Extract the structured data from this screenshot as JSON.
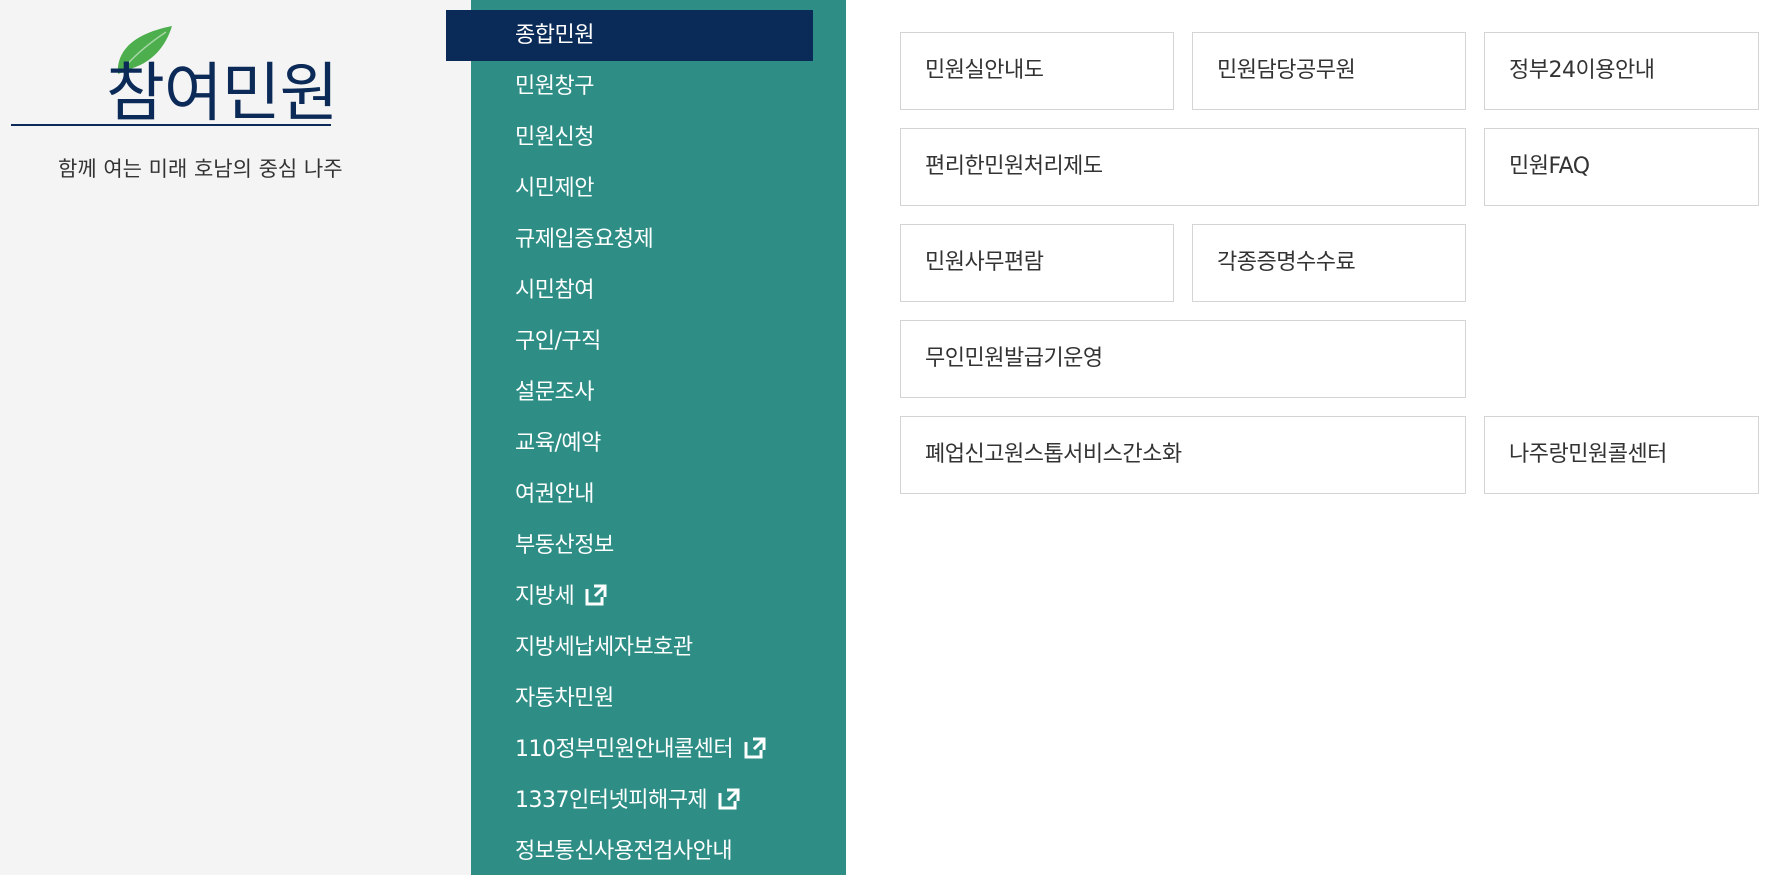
{
  "brand": {
    "title": "참여민원",
    "slogan": "함께 여는 미래 호남의 중심 나주",
    "leaf_color": "#4cae4c",
    "title_color": "#0b2a58"
  },
  "colors": {
    "nav_bg": "#2e8e86",
    "nav_active_bg": "#0a2b57",
    "panel_bg": "#f4f4f4",
    "box_border": "#d4d4d4"
  },
  "nav": {
    "items": [
      {
        "label": "종합민원",
        "active": true
      },
      {
        "label": "민원창구"
      },
      {
        "label": "민원신청"
      },
      {
        "label": "시민제안"
      },
      {
        "label": "규제입증요청제"
      },
      {
        "label": "시민참여"
      },
      {
        "label": "구인/구직"
      },
      {
        "label": "설문조사"
      },
      {
        "label": "교육/예약"
      },
      {
        "label": "여권안내"
      },
      {
        "label": "부동산정보"
      },
      {
        "label": "지방세",
        "external": true,
        "icon": "external-link-icon"
      },
      {
        "label": "지방세납세자보호관"
      },
      {
        "label": "자동차민원"
      },
      {
        "label": "110정부민원안내콜센터",
        "external": true,
        "icon": "external-link-icon"
      },
      {
        "label": "1337인터넷피해구제",
        "external": true,
        "icon": "external-link-icon"
      },
      {
        "label": "정보통신사용전검사안내"
      }
    ]
  },
  "submenu": {
    "items": [
      "민원실안내도",
      "민원담당공무원",
      "정부24이용안내",
      "편리한민원처리제도",
      "민원FAQ",
      "민원사무편람",
      "각종증명수수료",
      "무인민원발급기운영",
      "폐업신고원스톱서비스간소화",
      "나주랑민원콜센터"
    ]
  }
}
